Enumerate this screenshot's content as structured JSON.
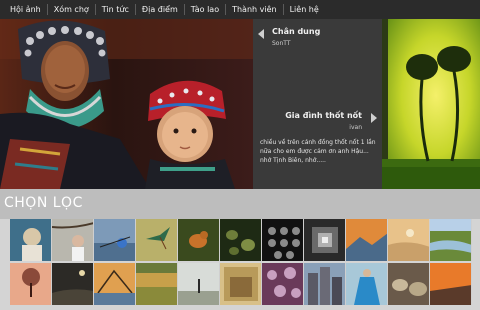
{
  "nav": {
    "items": [
      {
        "label": "Hội ảnh"
      },
      {
        "label": "Xóm chợ"
      },
      {
        "label": "Tin tức"
      },
      {
        "label": "Địa điểm"
      },
      {
        "label": "Tào lao"
      },
      {
        "label": "Thành viên"
      },
      {
        "label": "Liên hệ"
      }
    ]
  },
  "featured": {
    "top": {
      "title": "Chân dung",
      "author": "SonTT"
    },
    "bottom": {
      "title": "Gia đình thốt nốt",
      "author": "ivan"
    },
    "description": "chiều về trên cánh đồng thốt nốt 1 lần nữa cho em được cảm ơn anh Hậu... nhớ Tịnh Biên, nhớ....."
  },
  "section": {
    "title": "CHỌN LỌC"
  },
  "thumbnails": [
    {
      "icon": "portrait-photo"
    },
    {
      "icon": "woman-branch-photo"
    },
    {
      "icon": "fishing-photo"
    },
    {
      "icon": "hummingbird-photo"
    },
    {
      "icon": "bird-photo"
    },
    {
      "icon": "shells-photo"
    },
    {
      "icon": "spheres-photo"
    },
    {
      "icon": "tunnel-photo"
    },
    {
      "icon": "mountain-sunset-photo"
    },
    {
      "icon": "desert-photo"
    },
    {
      "icon": "river-photo"
    },
    {
      "icon": "tree-photo"
    },
    {
      "icon": "dark-sky-photo"
    },
    {
      "icon": "fishing-net-photo"
    },
    {
      "icon": "field-photo"
    },
    {
      "icon": "lone-tree-photo"
    },
    {
      "icon": "wall-photo"
    },
    {
      "icon": "flowers-photo"
    },
    {
      "icon": "buildings-photo"
    },
    {
      "icon": "blue-dress-photo"
    },
    {
      "icon": "baskets-photo"
    },
    {
      "icon": "orange-sky-photo"
    }
  ],
  "colors": {
    "nav_bg": "#2b2b2b",
    "panel_bg": "#3a3a3a",
    "strip_bg": "#bdbdbd",
    "page_bg": "#d4d4d4"
  }
}
